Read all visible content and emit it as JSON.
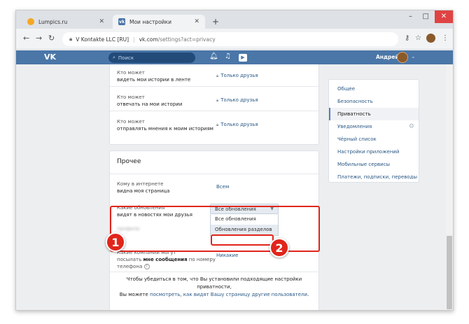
{
  "browser": {
    "tabs": [
      {
        "label": "Lumpics.ru"
      },
      {
        "label": "Мои настройки"
      }
    ],
    "new_tab": "+",
    "window_controls": {
      "minimize": "–",
      "maximize": "□",
      "close": "✕"
    },
    "address": {
      "site_identity": "V Kontakte LLC [RU]",
      "domain": "vk.com",
      "path": "/settings?act=privacy"
    }
  },
  "vk_header": {
    "logo": "VK",
    "search_placeholder": "Поиск",
    "user_name": "Андрей"
  },
  "privacy": {
    "story_rows": [
      {
        "line1": "Кто может",
        "line2": "видеть мои истории в ленте",
        "value": "Только друзья"
      },
      {
        "line1": "Кто может",
        "line2": "отвечать на мои истории",
        "value": "Только друзья"
      },
      {
        "line1": "Кто может",
        "line2": "отправлять мнения к моим историям",
        "value": "Только друзья"
      }
    ],
    "other_section": {
      "title": "Прочее",
      "page_visibility": {
        "line1": "Кому в интернете",
        "line2": "видна моя страница",
        "value": "Всем"
      },
      "updates": {
        "line1": "Какие обновления",
        "line2": "видят в новостях мои друзья",
        "value": "Все обновления"
      },
      "dropdown_options": [
        "Все обновления",
        "Обновления разделов"
      ],
      "blurred_text": "профиле",
      "companies": {
        "line1": "Какие компании могут",
        "line2_pre": "посылать ",
        "line2_bold": "мне сообщения",
        "line2_post": " по номеру",
        "line3": "телефона",
        "value": "Никакие"
      }
    },
    "footer": {
      "line1": "Чтобы убедиться в том, что Вы установили подходящие настройки приватности,",
      "line2_pre": "Вы можете ",
      "line2_link": "посмотреть, как видят Вашу страницу другие пользователи",
      "line2_post": "."
    }
  },
  "settings_menu": {
    "items": [
      {
        "label": "Общее"
      },
      {
        "label": "Безопасность"
      },
      {
        "label": "Приватность"
      },
      {
        "label": "Уведомления"
      },
      {
        "label": "Чёрный список"
      },
      {
        "label": "Настройки приложений"
      },
      {
        "label": "Мобильные сервисы"
      },
      {
        "label": "Платежи, подписки, переводы"
      }
    ],
    "active_index": 2
  },
  "annotations": {
    "badge1": "1",
    "badge2": "2",
    "highlight_color": "#e1251b"
  },
  "colors": {
    "vk_blue": "#4a76a8",
    "link": "#2a5885"
  }
}
